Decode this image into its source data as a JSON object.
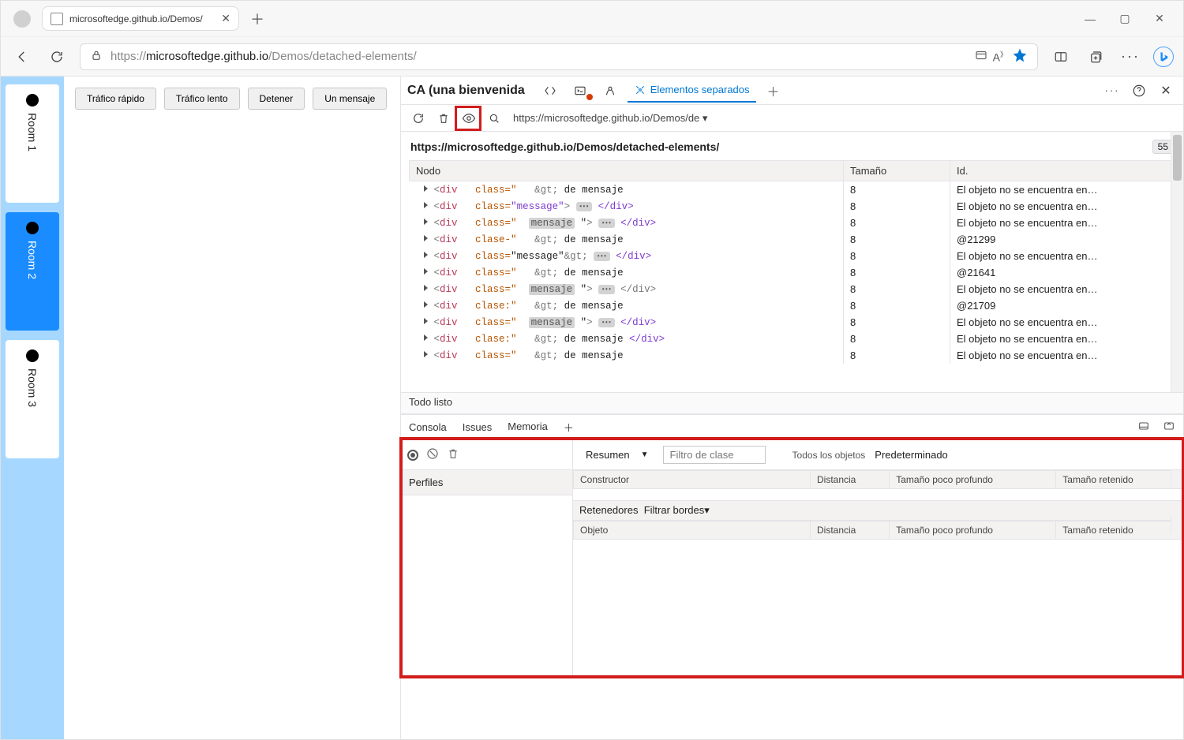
{
  "browser": {
    "tab_title": "microsoftedge.github.io/Demos/",
    "url_host": "microsoftedge.github.io",
    "url_path": "/Demos/detached-elements/",
    "winbtns": {
      "min": "—",
      "max": "▢",
      "close": "✕"
    }
  },
  "page": {
    "rooms": [
      "Room 1",
      "Room 2",
      "Room 3"
    ],
    "active_room": 1,
    "buttons": [
      "Tráfico rápido",
      "Tráfico lento",
      "Detener",
      "Un mensaje"
    ]
  },
  "devtools": {
    "title": "CA (una bienvenida",
    "tabs": {
      "detached": "Elementos separados"
    },
    "url_filter": "https://microsoftedge.github.io/Demos/de",
    "group_url": "https://microsoftedge.github.io/Demos/detached-elements/",
    "group_count": "55",
    "columns": {
      "node": "Nodo",
      "size": "Tamaño",
      "id": "Id."
    },
    "rows": [
      {
        "node_html": "<span class='tw'></span><span class='t-dim'>&lt;</span><span class='t-tag'>div</span>&nbsp;&nbsp;&nbsp;<span class='t-attr'>class=\"</span>&nbsp;&nbsp;&nbsp;<span class='t-dim'>&amp;gt;</span> de mensaje",
        "size": "8",
        "id": "El objeto no se encuentra en…"
      },
      {
        "node_html": "<span class='tw'></span><span class='t-dim'>&lt;</span><span class='t-tag'>div</span>&nbsp;&nbsp;&nbsp;<span class='t-attr'>class=</span><span class='t-val'>\"message\"</span><span class='t-dim'>&gt;</span> <span class='ell'>⋯</span> <span class='t-end'>&lt;/div&gt;</span>",
        "size": "8",
        "id": "El objeto no se encuentra en…"
      },
      {
        "node_html": "<span class='tw'></span><span class='t-dim'>&lt;</span><span class='t-tag'>div</span>&nbsp;&nbsp;&nbsp;<span class='t-attr'>class=\"</span>&nbsp;&nbsp;<span class='chip'>mensaje</span>&nbsp;\"<span class='t-dim'>&gt;</span> <span class='ell'>⋯</span> <span class='t-end'>&lt;/div&gt;</span>",
        "size": "8",
        "id": "El objeto no se encuentra en…"
      },
      {
        "node_html": "<span class='tw'></span><span class='t-dim'>&lt;</span><span class='t-tag'>div</span>&nbsp;&nbsp;&nbsp;<span class='t-attr'>clase-\"</span>&nbsp;&nbsp;&nbsp;<span class='t-dim'>&amp;gt;</span> de mensaje",
        "size": "8",
        "id": "@21299"
      },
      {
        "node_html": "<span class='tw'></span><span class='t-dim'>&lt;</span><span class='t-tag'>div</span>&nbsp;&nbsp;&nbsp;<span class='t-attr'>class=</span>\"message\"<span class='t-dim'>&amp;gt;</span> <span class='ell'>⋯</span> <span class='t-end'>&lt;/div&gt;</span>",
        "size": "8",
        "id": "El objeto no se encuentra en…"
      },
      {
        "node_html": "<span class='tw'></span><span class='t-dim'>&lt;</span><span class='t-tag'>div</span>&nbsp;&nbsp;&nbsp;<span class='t-attr'>class=\"</span>&nbsp;&nbsp;&nbsp;<span class='t-dim'>&amp;gt;</span> de mensaje",
        "size": "8",
        "id": "@21641"
      },
      {
        "node_html": "<span class='tw'></span><span class='t-dim'>&lt;</span><span class='t-tag'>div</span>&nbsp;&nbsp;&nbsp;<span class='t-attr'>class=\"</span>&nbsp;&nbsp;<span class='chip'>mensaje</span>&nbsp;\"<span class='t-dim'>&gt;</span> <span class='ell'>⋯</span> <span class='t-dim'>&lt;/div&gt;</span>",
        "size": "8",
        "id": "El objeto no se encuentra en…"
      },
      {
        "node_html": "<span class='tw'></span><span class='t-dim'>&lt;</span><span class='t-tag'>div</span>&nbsp;&nbsp;&nbsp;<span class='t-attr'>clase:\"</span>&nbsp;&nbsp;&nbsp;<span class='t-dim'>&amp;gt;</span> de mensaje",
        "size": "8",
        "id": "@21709"
      },
      {
        "node_html": "<span class='tw'></span><span class='t-dim'>&lt;</span><span class='t-tag'>div</span>&nbsp;&nbsp;&nbsp;<span class='t-attr'>class=\"</span>&nbsp;&nbsp;<span class='chip'>mensaje</span>&nbsp;\"<span class='t-dim'>&gt;</span> <span class='ell'>⋯</span> <span class='t-end'>&lt;/div&gt;</span>",
        "size": "8",
        "id": "El objeto no se encuentra en…"
      },
      {
        "node_html": "<span class='tw'></span><span class='t-dim'>&lt;</span><span class='t-tag'>div</span>&nbsp;&nbsp;&nbsp;<span class='t-attr'>clase:\"</span>&nbsp;&nbsp;&nbsp;<span class='t-dim'>&amp;gt;</span> de mensaje <span class='t-end'>&lt;/div&gt;</span>",
        "size": "8",
        "id": "El objeto no se encuentra en…"
      },
      {
        "node_html": "<span class='tw'></span><span class='t-dim'>&lt;</span><span class='t-tag'>div</span>&nbsp;&nbsp;&nbsp;<span class='t-attr'>class=\"</span>&nbsp;&nbsp;&nbsp;<span class='t-dim'>&amp;gt;</span> de mensaje",
        "size": "8",
        "id": "El objeto no se encuentra en…"
      }
    ],
    "status": "Todo listo"
  },
  "drawer": {
    "tabs": [
      "Consola",
      "Issues",
      "Memoria"
    ],
    "active": 2,
    "summary_label": "Resumen",
    "filter_placeholder": "Filtro de clase",
    "scope_label": "Todos los objetos",
    "default_label": "Predeterminado",
    "profiles_label": "Perfiles",
    "cols1": [
      "Constructor",
      "Distancia",
      "Tamaño poco profundo",
      "Tamaño retenido"
    ],
    "retainers_label": "Retenedores",
    "filter_edges": "Filtrar bordes",
    "cols2": [
      "Objeto",
      "Distancia",
      "Tamaño poco profundo",
      "Tamaño retenido"
    ]
  }
}
